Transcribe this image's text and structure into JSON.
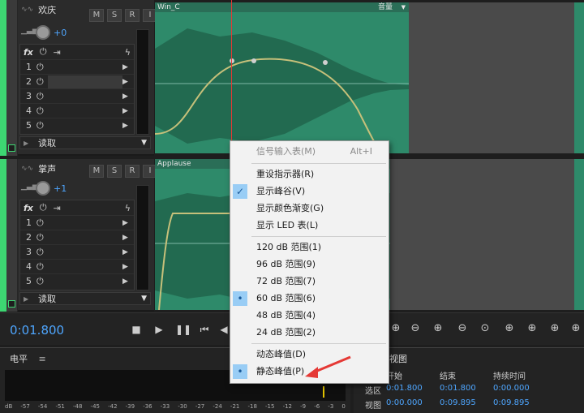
{
  "tracks": [
    {
      "name": "欢庆",
      "buttons": [
        "M",
        "S",
        "R",
        "I"
      ],
      "volume": "+0",
      "fx_label": "fx",
      "slots": [
        "1",
        "2",
        "3",
        "4",
        "5"
      ],
      "read_mode": "读取",
      "clip_name": "Win_C",
      "clip_param": "音量"
    },
    {
      "name": "掌声",
      "buttons": [
        "M",
        "S",
        "R",
        "I"
      ],
      "volume": "+1",
      "fx_label": "fx",
      "slots": [
        "1",
        "2",
        "3",
        "4",
        "5"
      ],
      "read_mode": "读取",
      "clip_name": "Applause",
      "clip_param": ""
    }
  ],
  "transport": {
    "time": "0:01.800"
  },
  "level_panel": {
    "title": "电平",
    "menu_icon": "≡",
    "scale": [
      "dB",
      "-57",
      "-54",
      "-51",
      "-48",
      "-45",
      "-42",
      "-39",
      "-36",
      "-33",
      "-30",
      "-27",
      "-24",
      "-21",
      "-18",
      "-15",
      "-12",
      "-9",
      "-6",
      "-3",
      "0"
    ]
  },
  "selection_panel": {
    "title": "视图",
    "col_start": "开始",
    "col_end": "结束",
    "col_duration": "持续时间",
    "row_selection": "选区",
    "row_view": "视图",
    "sel_start": "0:01.800",
    "sel_end": "0:01.800",
    "sel_duration": "0:00.000",
    "view_start": "0:00.000",
    "view_end": "0:09.895",
    "view_duration": "0:09.895"
  },
  "menu": {
    "items": [
      {
        "label": "信号输入表(M)",
        "accel": "Alt+I",
        "disabled": true,
        "mark": ""
      },
      {
        "label": "重设指示器(R)",
        "accel": "",
        "disabled": false,
        "mark": ""
      },
      {
        "label": "显示峰谷(V)",
        "accel": "",
        "disabled": false,
        "mark": "✓"
      },
      {
        "label": "显示颜色渐变(G)",
        "accel": "",
        "disabled": false,
        "mark": ""
      },
      {
        "label": "显示 LED 表(L)",
        "accel": "",
        "disabled": false,
        "mark": ""
      },
      {
        "label": "120 dB 范围(1)",
        "accel": "",
        "disabled": false,
        "mark": ""
      },
      {
        "label": "96 dB 范围(9)",
        "accel": "",
        "disabled": false,
        "mark": ""
      },
      {
        "label": "72 dB 范围(7)",
        "accel": "",
        "disabled": false,
        "mark": ""
      },
      {
        "label": "60 dB 范围(6)",
        "accel": "",
        "disabled": false,
        "mark": "•"
      },
      {
        "label": "48 dB 范围(4)",
        "accel": "",
        "disabled": false,
        "mark": ""
      },
      {
        "label": "24 dB 范围(2)",
        "accel": "",
        "disabled": false,
        "mark": ""
      },
      {
        "label": "动态峰值(D)",
        "accel": "",
        "disabled": false,
        "mark": ""
      },
      {
        "label": "静态峰值(P)",
        "accel": "",
        "disabled": false,
        "mark": "•"
      }
    ]
  },
  "colors": {
    "accent_blue": "#4ea6ff",
    "track_green": "#3dd672",
    "waveform": "#2e8a6a",
    "menu_check_bg": "#99cdf5",
    "annotation_arrow": "#e53935"
  }
}
